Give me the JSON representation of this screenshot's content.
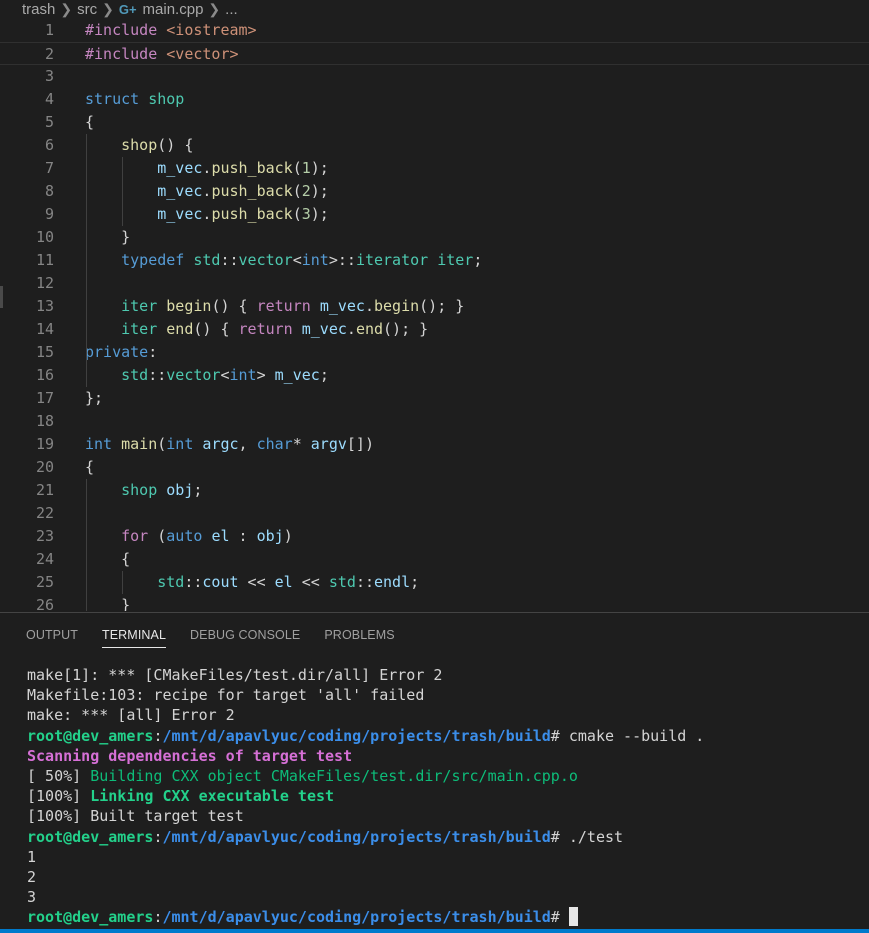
{
  "breadcrumb": {
    "items": [
      "trash",
      "src",
      "main.cpp",
      "..."
    ],
    "file_icon": "C++ file icon (G+)"
  },
  "editor": {
    "current_line": 2,
    "lines": [
      {
        "n": "1",
        "tokens": [
          [
            "pp",
            "#include "
          ],
          [
            "str",
            "<iostream>"
          ]
        ]
      },
      {
        "n": "2",
        "tokens": [
          [
            "pp",
            "#include "
          ],
          [
            "str",
            "<vector>"
          ]
        ]
      },
      {
        "n": "3",
        "tokens": []
      },
      {
        "n": "4",
        "tokens": [
          [
            "kw",
            "struct "
          ],
          [
            "ty",
            "shop"
          ]
        ]
      },
      {
        "n": "5",
        "tokens": [
          [
            "pl",
            "{"
          ]
        ]
      },
      {
        "n": "6",
        "tokens": [
          [
            "pl",
            "    "
          ],
          [
            "fn",
            "shop"
          ],
          [
            "pl",
            "() {"
          ]
        ]
      },
      {
        "n": "7",
        "tokens": [
          [
            "pl",
            "        "
          ],
          [
            "var",
            "m_vec"
          ],
          [
            "pl",
            "."
          ],
          [
            "fn",
            "push_back"
          ],
          [
            "pl",
            "("
          ],
          [
            "num",
            "1"
          ],
          [
            "pl",
            ");"
          ]
        ]
      },
      {
        "n": "8",
        "tokens": [
          [
            "pl",
            "        "
          ],
          [
            "var",
            "m_vec"
          ],
          [
            "pl",
            "."
          ],
          [
            "fn",
            "push_back"
          ],
          [
            "pl",
            "("
          ],
          [
            "num",
            "2"
          ],
          [
            "pl",
            ");"
          ]
        ]
      },
      {
        "n": "9",
        "tokens": [
          [
            "pl",
            "        "
          ],
          [
            "var",
            "m_vec"
          ],
          [
            "pl",
            "."
          ],
          [
            "fn",
            "push_back"
          ],
          [
            "pl",
            "("
          ],
          [
            "num",
            "3"
          ],
          [
            "pl",
            ");"
          ]
        ]
      },
      {
        "n": "10",
        "tokens": [
          [
            "pl",
            "    }"
          ]
        ]
      },
      {
        "n": "11",
        "tokens": [
          [
            "pl",
            "    "
          ],
          [
            "kw",
            "typedef "
          ],
          [
            "ty",
            "std"
          ],
          [
            "pl",
            "::"
          ],
          [
            "ty",
            "vector"
          ],
          [
            "pl",
            "<"
          ],
          [
            "kw",
            "int"
          ],
          [
            "pl",
            ">::"
          ],
          [
            "ty",
            "iterator "
          ],
          [
            "ty",
            "iter"
          ],
          [
            "pl",
            ";"
          ]
        ]
      },
      {
        "n": "12",
        "tokens": []
      },
      {
        "n": "13",
        "tokens": [
          [
            "pl",
            "    "
          ],
          [
            "ty",
            "iter "
          ],
          [
            "fn",
            "begin"
          ],
          [
            "pl",
            "() { "
          ],
          [
            "ctl",
            "return "
          ],
          [
            "var",
            "m_vec"
          ],
          [
            "pl",
            "."
          ],
          [
            "fn",
            "begin"
          ],
          [
            "pl",
            "(); }"
          ]
        ]
      },
      {
        "n": "14",
        "tokens": [
          [
            "pl",
            "    "
          ],
          [
            "ty",
            "iter "
          ],
          [
            "fn",
            "end"
          ],
          [
            "pl",
            "() { "
          ],
          [
            "ctl",
            "return "
          ],
          [
            "var",
            "m_vec"
          ],
          [
            "pl",
            "."
          ],
          [
            "fn",
            "end"
          ],
          [
            "pl",
            "(); }"
          ]
        ]
      },
      {
        "n": "15",
        "tokens": [
          [
            "kw",
            "private"
          ],
          [
            "pl",
            ":"
          ]
        ]
      },
      {
        "n": "16",
        "tokens": [
          [
            "pl",
            "    "
          ],
          [
            "ty",
            "std"
          ],
          [
            "pl",
            "::"
          ],
          [
            "ty",
            "vector"
          ],
          [
            "pl",
            "<"
          ],
          [
            "kw",
            "int"
          ],
          [
            "pl",
            "> "
          ],
          [
            "var",
            "m_vec"
          ],
          [
            "pl",
            ";"
          ]
        ]
      },
      {
        "n": "17",
        "tokens": [
          [
            "pl",
            "};"
          ]
        ]
      },
      {
        "n": "18",
        "tokens": []
      },
      {
        "n": "19",
        "tokens": [
          [
            "kw",
            "int "
          ],
          [
            "fn",
            "main"
          ],
          [
            "pl",
            "("
          ],
          [
            "kw",
            "int "
          ],
          [
            "var",
            "argc"
          ],
          [
            "pl",
            ", "
          ],
          [
            "kw",
            "char"
          ],
          [
            "pl",
            "* "
          ],
          [
            "var",
            "argv"
          ],
          [
            "pl",
            "[])"
          ]
        ]
      },
      {
        "n": "20",
        "tokens": [
          [
            "pl",
            "{"
          ]
        ]
      },
      {
        "n": "21",
        "tokens": [
          [
            "pl",
            "    "
          ],
          [
            "ty",
            "shop "
          ],
          [
            "var",
            "obj"
          ],
          [
            "pl",
            ";"
          ]
        ]
      },
      {
        "n": "22",
        "tokens": []
      },
      {
        "n": "23",
        "tokens": [
          [
            "pl",
            "    "
          ],
          [
            "ctl",
            "for "
          ],
          [
            "pl",
            "("
          ],
          [
            "kw",
            "auto "
          ],
          [
            "var",
            "el"
          ],
          [
            "pl",
            " : "
          ],
          [
            "var",
            "obj"
          ],
          [
            "pl",
            ")"
          ]
        ]
      },
      {
        "n": "24",
        "tokens": [
          [
            "pl",
            "    {"
          ]
        ]
      },
      {
        "n": "25",
        "tokens": [
          [
            "pl",
            "        "
          ],
          [
            "ty",
            "std"
          ],
          [
            "pl",
            "::"
          ],
          [
            "var",
            "cout"
          ],
          [
            "pl",
            " << "
          ],
          [
            "var",
            "el"
          ],
          [
            "pl",
            " << "
          ],
          [
            "ty",
            "std"
          ],
          [
            "pl",
            "::"
          ],
          [
            "var",
            "endl"
          ],
          [
            "pl",
            ";"
          ]
        ]
      },
      {
        "n": "26",
        "tokens": [
          [
            "pl",
            "    }"
          ]
        ]
      }
    ]
  },
  "panel": {
    "tabs": [
      "OUTPUT",
      "TERMINAL",
      "DEBUG CONSOLE",
      "PROBLEMS"
    ],
    "active_tab": 1
  },
  "terminal": {
    "lines": [
      [
        [
          "",
          "make[1]: *** [CMakeFiles/test.dir/all] Error 2"
        ]
      ],
      [
        [
          "",
          "Makefile:103: recipe for target 'all' failed"
        ]
      ],
      [
        [
          "",
          "make: *** [all] Error 2"
        ]
      ],
      [
        [
          "t-green",
          "root@dev_amers"
        ],
        [
          "",
          ":"
        ],
        [
          "t-blue",
          "/mnt/d/apavlyuc/coding/projects/trash/build"
        ],
        [
          "",
          "# cmake --build ."
        ]
      ],
      [
        [
          "t-mag",
          "Scanning dependencies of target test"
        ]
      ],
      [
        [
          "",
          "[ 50%] "
        ],
        [
          "t-dgreen",
          "Building CXX object CMakeFiles/test.dir/src/main.cpp.o"
        ]
      ],
      [
        [
          "",
          "[100%] "
        ],
        [
          "t-bgreen",
          "Linking CXX executable test"
        ]
      ],
      [
        [
          "",
          "[100%] Built target test"
        ]
      ],
      [
        [
          "t-green",
          "root@dev_amers"
        ],
        [
          "",
          ":"
        ],
        [
          "t-blue",
          "/mnt/d/apavlyuc/coding/projects/trash/build"
        ],
        [
          "",
          "# ./test"
        ]
      ],
      [
        [
          "",
          "1"
        ]
      ],
      [
        [
          "",
          "2"
        ]
      ],
      [
        [
          "",
          "3"
        ]
      ],
      [
        [
          "t-green",
          "root@dev_amers"
        ],
        [
          "",
          ":"
        ],
        [
          "t-blue",
          "/mnt/d/apavlyuc/coding/projects/trash/build"
        ],
        [
          "",
          "# "
        ]
      ]
    ]
  },
  "colors": {
    "background": "#1e1e1e",
    "status_bar": "#007acc",
    "prompt_user": "#23d18b",
    "prompt_path": "#3b8eea"
  }
}
